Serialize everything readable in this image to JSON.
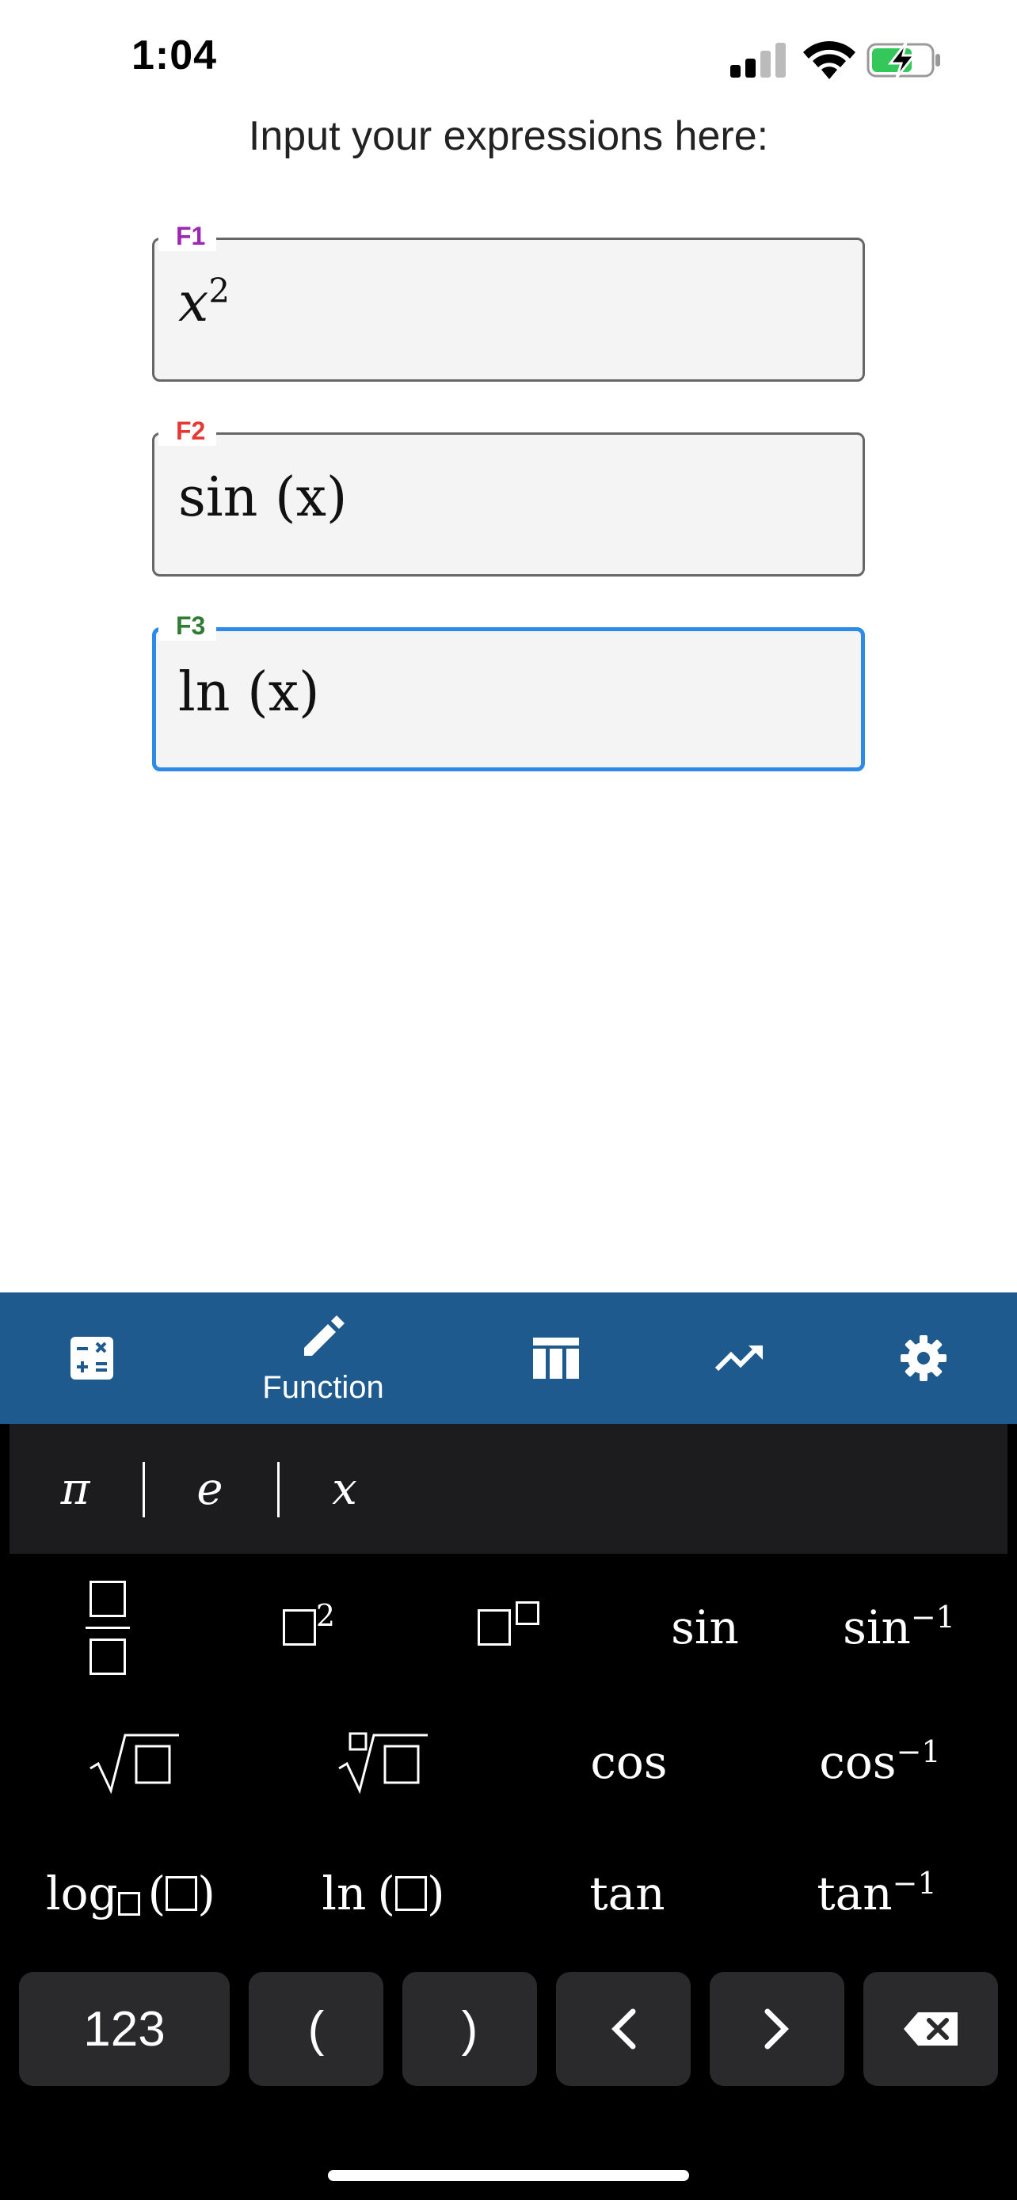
{
  "status": {
    "time": "1:04"
  },
  "heading": "Input your expressions here:",
  "fields": [
    {
      "label": "F1",
      "label_color": "#9c27b0",
      "value_base": "x",
      "value_sup": "2",
      "active": false
    },
    {
      "label": "F2",
      "label_color": "#e53935",
      "value": "sin (x)",
      "active": false
    },
    {
      "label": "F3",
      "label_color": "#2e7d32",
      "value": "ln (x)",
      "active": true
    }
  ],
  "nav": {
    "items": [
      {
        "icon": "calculator-icon",
        "label": ""
      },
      {
        "icon": "pencil-icon",
        "label": "Function",
        "selected": true
      },
      {
        "icon": "table-icon",
        "label": ""
      },
      {
        "icon": "graph-icon",
        "label": ""
      },
      {
        "icon": "gear-icon",
        "label": ""
      }
    ],
    "background": "#1e5a8e"
  },
  "keyboard": {
    "variables": [
      "π",
      "e",
      "x"
    ],
    "rows": [
      [
        "fraction",
        "square",
        "power",
        "sin",
        "sin⁻¹"
      ],
      [
        "sqrt",
        "nth-root",
        "cos",
        "cos⁻¹"
      ],
      [
        "log",
        "ln",
        "tan",
        "tan⁻¹"
      ]
    ],
    "labels": {
      "sin": "sin",
      "cos": "cos",
      "tan": "tan",
      "sin_inv_base": "sin",
      "cos_inv_base": "cos",
      "tan_inv_base": "tan",
      "inv_sup": "−1",
      "square_sup": "2",
      "log": "log",
      "ln": "ln",
      "lparen": "(",
      "rparen": ")"
    },
    "bottom": {
      "numbers": "123",
      "open_paren": "(",
      "close_paren": ")"
    }
  }
}
